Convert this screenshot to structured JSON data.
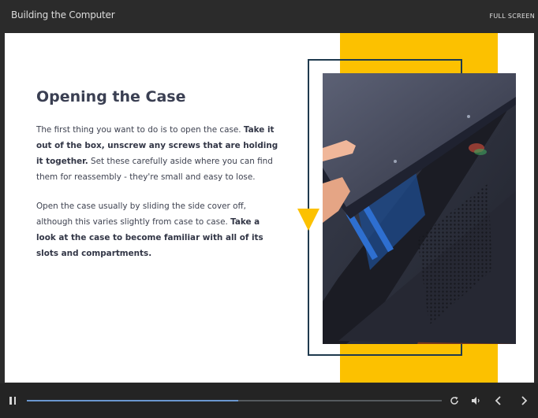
{
  "header": {
    "course_title": "Building the Computer",
    "fullscreen_label": "FULL SCREEN"
  },
  "slide": {
    "heading": "Opening the Case",
    "paragraph1": {
      "text_a": "The first thing you want to do is to open the case. ",
      "bold_a": "Take it out of the box, unscrew any screws that are holding it together.",
      "text_b": " Set these carefully aside where you can find them for reassembly - they're small and easy to lose."
    },
    "paragraph2": {
      "text_a": "Open the case usually by sliding the side cover off, although this varies slightly from case to case. ",
      "bold_a": "Take a look at the case to become familiar with all of its slots and compartments."
    },
    "accent_color": "#fcc100",
    "frame_color": "#1f3a4e"
  },
  "player": {
    "progress": 0.51,
    "icons": {
      "pause": "pause-icon",
      "replay": "replay-icon",
      "volume": "volume-icon",
      "prev": "chevron-left-icon",
      "next": "chevron-right-icon"
    }
  }
}
